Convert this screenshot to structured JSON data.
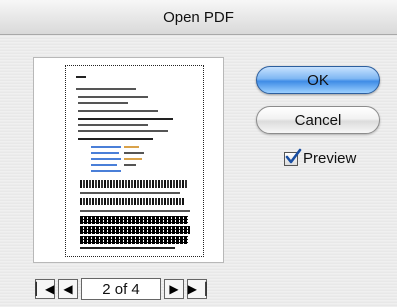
{
  "window": {
    "title": "Open PDF"
  },
  "buttons": {
    "ok_label": "OK",
    "cancel_label": "Cancel"
  },
  "options": {
    "preview_label": "Preview",
    "preview_checked": true
  },
  "navigation": {
    "page_indicator": "2 of 4",
    "first_icon": "first-page-icon",
    "prev_icon": "previous-page-icon",
    "next_icon": "next-page-icon",
    "last_icon": "last-page-icon"
  },
  "colors": {
    "ok_accent": "#4a90e2",
    "checkmark": "#1a4fa3"
  }
}
